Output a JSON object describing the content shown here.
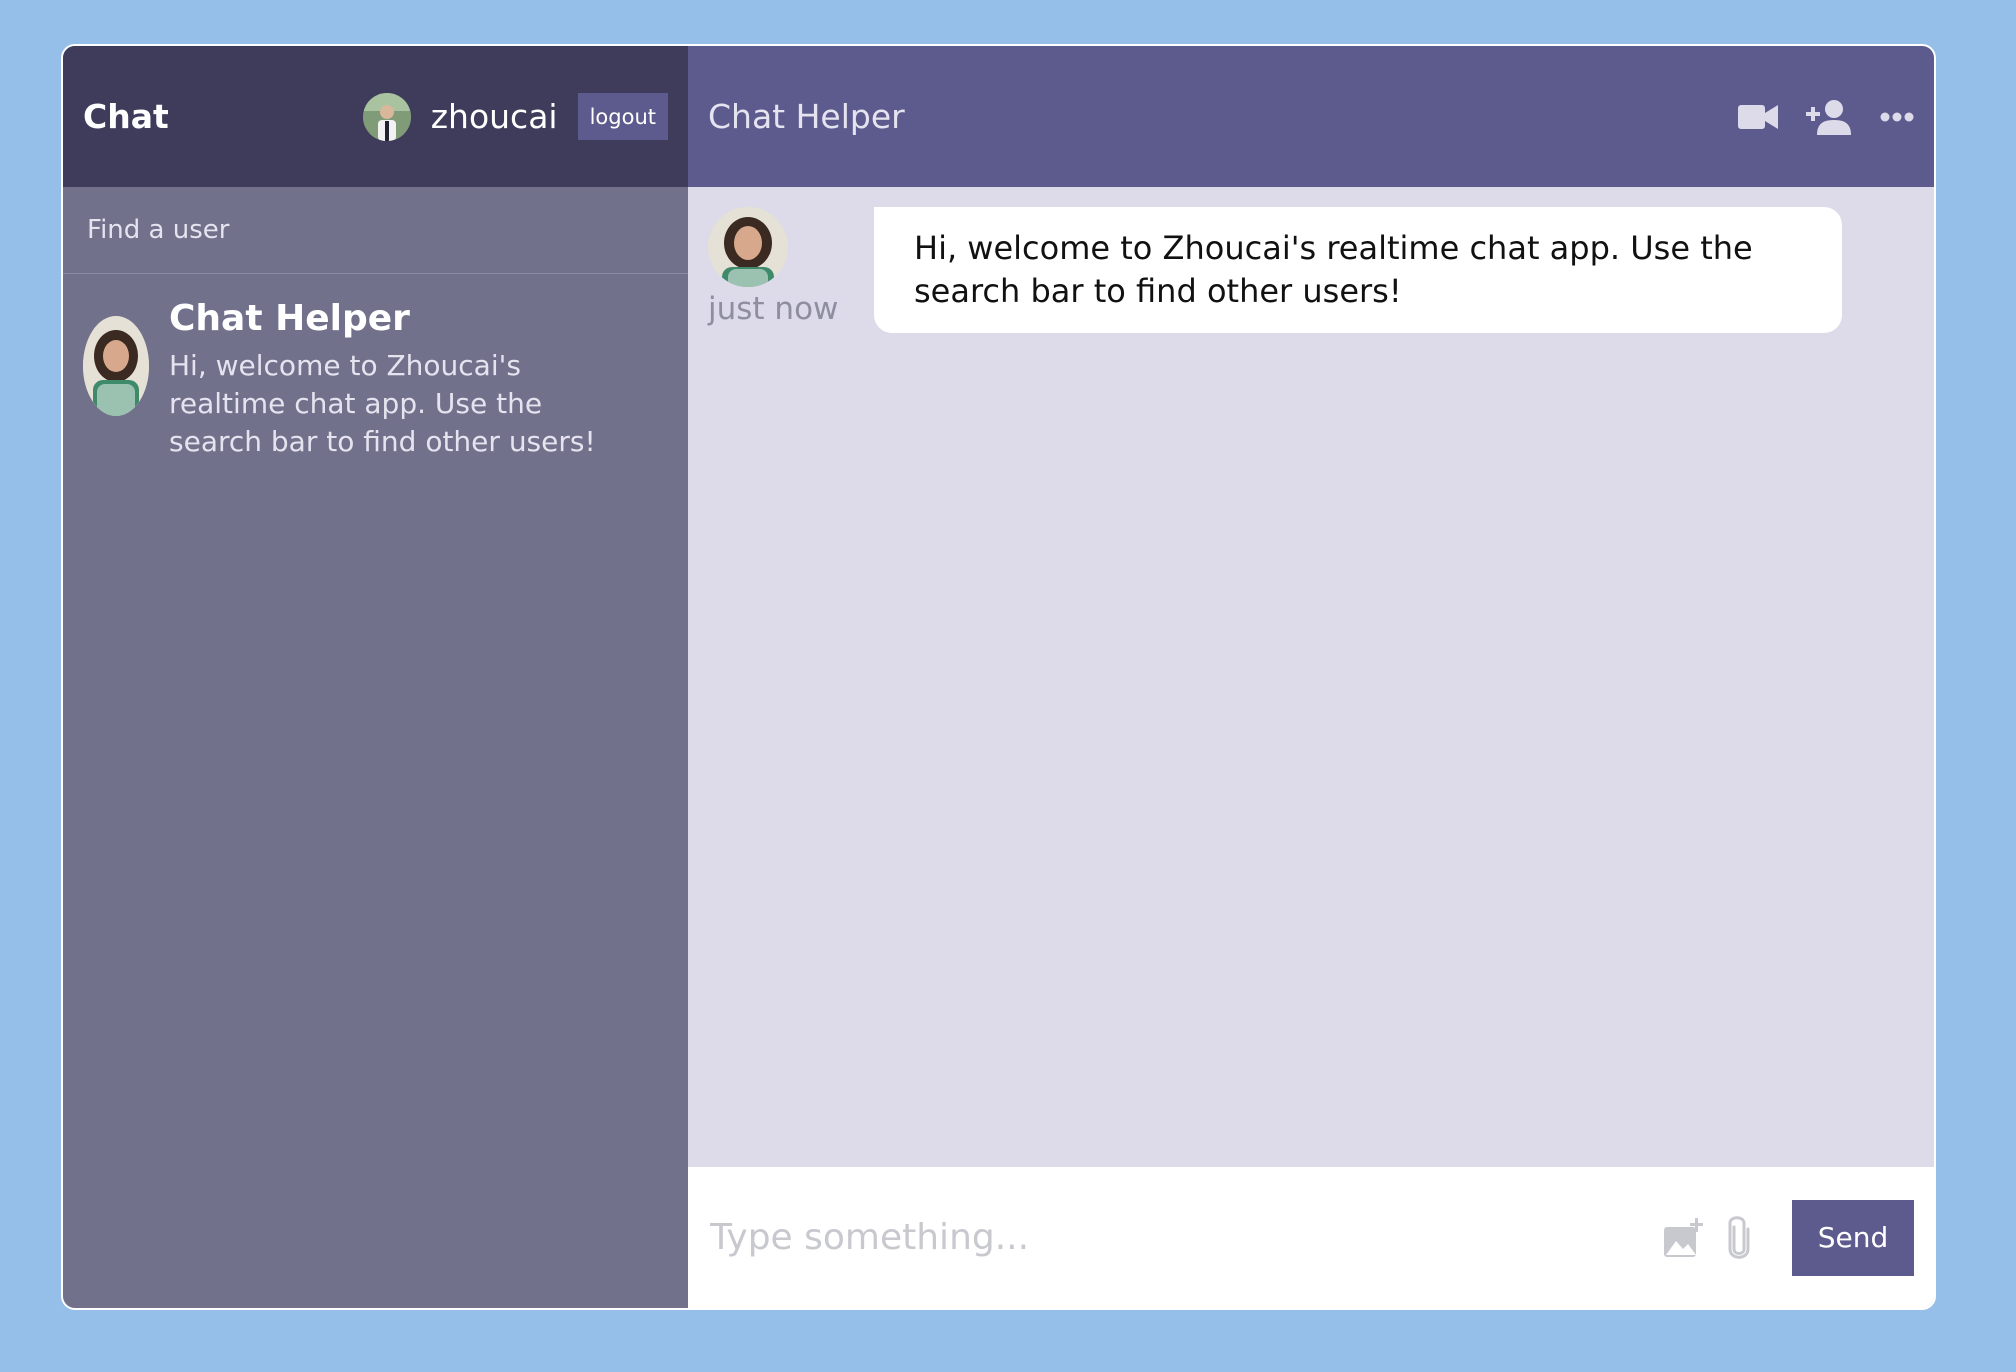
{
  "sidebar": {
    "brand": "Chat",
    "current_user": {
      "name": "zhoucai",
      "logout_label": "logout"
    },
    "search": {
      "placeholder": "Find a user"
    },
    "chats": [
      {
        "name": "Chat Helper",
        "last_message": "Hi, welcome to Zhoucai's realtime chat app. Use the search bar to find other users!"
      }
    ]
  },
  "chat": {
    "title": "Chat Helper",
    "header_icons": [
      "video-camera-icon",
      "add-user-icon",
      "more-icon"
    ],
    "messages": [
      {
        "time": "just now",
        "text": "Hi, welcome to Zhoucai's realtime chat app. Use the search bar to find other users!"
      }
    ],
    "input": {
      "placeholder": "Type something...",
      "value": ""
    },
    "input_icons": [
      "add-image-icon",
      "attach-icon"
    ],
    "send_label": "Send"
  },
  "colors": {
    "background": "#95bfe8",
    "sidebar": "#72718b",
    "sidebar_header": "#3e3c5a",
    "chat_header": "#5d5b8d",
    "chat_body": "#dddbea",
    "accent": "#5d5b8d"
  }
}
